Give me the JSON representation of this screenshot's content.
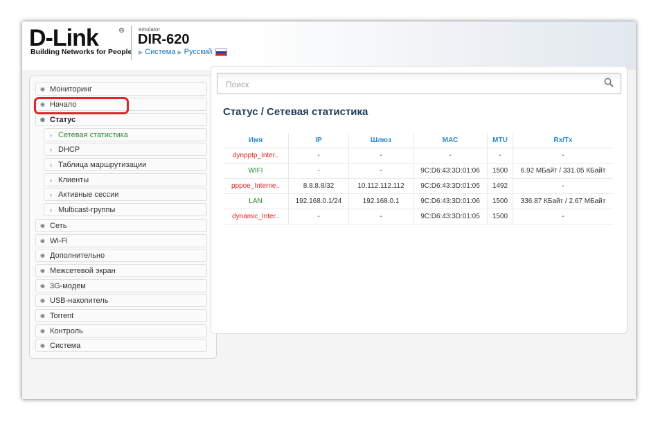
{
  "header": {
    "logo": "D-Link",
    "logo_reg": "®",
    "tagline": "Building Networks for People",
    "emulator_label": "emulator",
    "model": "DIR-620",
    "crumb_system": "Система",
    "crumb_language": "Русский",
    "flag_icon": "russia-flag-icon"
  },
  "sidebar": {
    "items": [
      {
        "label": "Мониторинг"
      },
      {
        "label": "Начало"
      },
      {
        "label": "Статус"
      },
      {
        "label": "Сеть"
      },
      {
        "label": "Wi-Fi"
      },
      {
        "label": "Дополнительно"
      },
      {
        "label": "Межсетевой экран"
      },
      {
        "label": "3G-модем"
      },
      {
        "label": "USB-накопитель"
      },
      {
        "label": "Torrent"
      },
      {
        "label": "Контроль"
      },
      {
        "label": "Система"
      }
    ],
    "status_sub": [
      {
        "label": "Сетевая статистика"
      },
      {
        "label": "DHCP"
      },
      {
        "label": "Таблица маршрутизации"
      },
      {
        "label": "Клиенты"
      },
      {
        "label": "Активные сессии"
      },
      {
        "label": "Multicast-группы"
      }
    ]
  },
  "search": {
    "placeholder": "Поиск",
    "value": ""
  },
  "page_title": "Статус /  Сетевая статистика",
  "table": {
    "headers": [
      "Имя",
      "IP",
      "Шлюз",
      "MAC",
      "MTU",
      "Rx/Tx"
    ],
    "rows": [
      {
        "name": "dynpptp_Inter..",
        "ip": "-",
        "gw": "-",
        "mac": "-",
        "mtu": "-",
        "rxtx": "-"
      },
      {
        "name": "WIFI",
        "ip": "-",
        "gw": "-",
        "mac": "9C:D6:43:3D:01:06",
        "mtu": "1500",
        "rxtx": "6.92 МБайт / 331.05 КБайт"
      },
      {
        "name": "pppoe_Interne..",
        "ip": "8.8.8.8/32",
        "gw": "10.112.112.112",
        "mac": "9C:D6:43:3D:01:05",
        "mtu": "1492",
        "rxtx": "-"
      },
      {
        "name": "LAN",
        "ip": "192.168.0.1/24",
        "gw": "192.168.0.1",
        "mac": "9C:D6:43:3D:01:06",
        "mtu": "1500",
        "rxtx": "336.87 КБайт / 2.67 МБайт"
      },
      {
        "name": "dynamic_Inter..",
        "ip": "-",
        "gw": "-",
        "mac": "9C:D6:43:3D:01:05",
        "mtu": "1500",
        "rxtx": "-"
      }
    ]
  },
  "colors": {
    "disconnected": "#d22222",
    "connected": "#2a8a2a",
    "highlight": "#e0222a",
    "header_accent": "#2a8ad0"
  }
}
